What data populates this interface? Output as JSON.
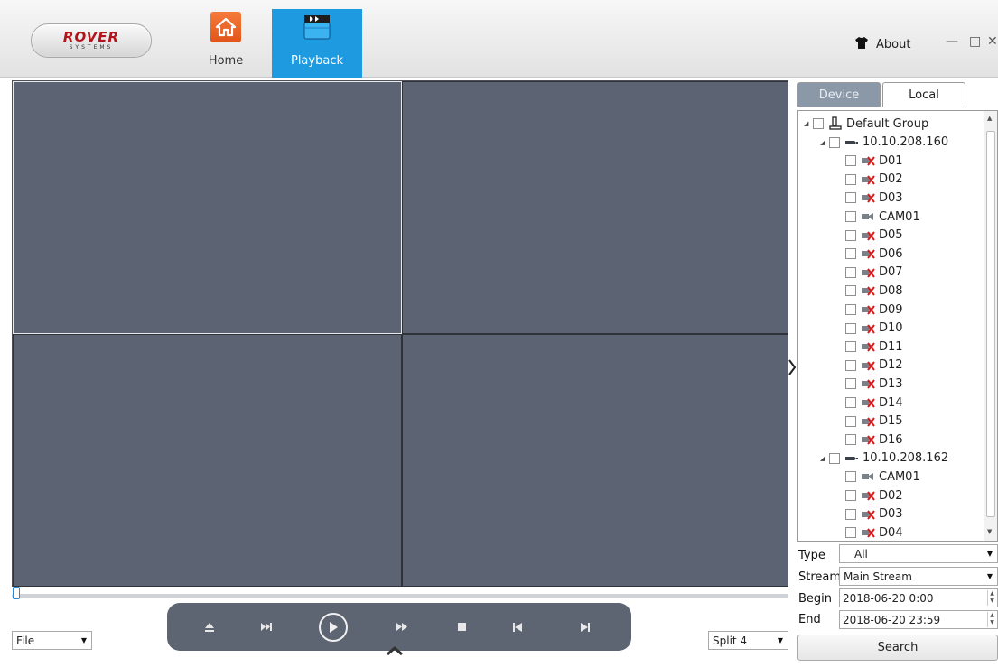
{
  "header": {
    "logo_main": "ROVER",
    "logo_sub": "SYSTEMS",
    "nav": [
      {
        "label": "Home",
        "icon": "home-icon"
      },
      {
        "label": "Playback",
        "icon": "playback-icon"
      }
    ],
    "about_label": "About",
    "window_controls": {
      "minimize": "—",
      "maximize": "□",
      "close": "✕"
    }
  },
  "colors": {
    "accent": "#1e9ae0",
    "video_bg": "#5c6373",
    "controls_bg": "#5d6472",
    "tab_active": "#8b98a8"
  },
  "video": {
    "split": 4,
    "active_pane": 0
  },
  "controls": {
    "file_select": "File",
    "split_select": "Split 4",
    "buttons": [
      "eject",
      "slow",
      "play",
      "fast",
      "stop",
      "prev-frame",
      "next-frame"
    ]
  },
  "panel": {
    "tabs": [
      {
        "label": "Device",
        "active": true
      },
      {
        "label": "Local",
        "active": false
      }
    ],
    "tree": {
      "group": "Default Group",
      "devices": [
        {
          "ip": "10.10.208.160",
          "channels": [
            {
              "name": "D01",
              "online": false
            },
            {
              "name": "D02",
              "online": false
            },
            {
              "name": "D03",
              "online": false
            },
            {
              "name": "CAM01",
              "online": true
            },
            {
              "name": "D05",
              "online": false
            },
            {
              "name": "D06",
              "online": false
            },
            {
              "name": "D07",
              "online": false
            },
            {
              "name": "D08",
              "online": false
            },
            {
              "name": "D09",
              "online": false
            },
            {
              "name": "D10",
              "online": false
            },
            {
              "name": "D11",
              "online": false
            },
            {
              "name": "D12",
              "online": false
            },
            {
              "name": "D13",
              "online": false
            },
            {
              "name": "D14",
              "online": false
            },
            {
              "name": "D15",
              "online": false
            },
            {
              "name": "D16",
              "online": false
            }
          ]
        },
        {
          "ip": "10.10.208.162",
          "channels": [
            {
              "name": "CAM01",
              "online": true
            },
            {
              "name": "D02",
              "online": false
            },
            {
              "name": "D03",
              "online": false
            },
            {
              "name": "D04",
              "online": false
            }
          ]
        }
      ]
    },
    "form": {
      "type_label": "Type",
      "type_value": "All",
      "stream_label": "Stream",
      "stream_value": "Main Stream",
      "begin_label": "Begin",
      "begin_value": "2018-06-20 0:00",
      "end_label": "End",
      "end_value": "2018-06-20 23:59",
      "search_label": "Search"
    }
  }
}
